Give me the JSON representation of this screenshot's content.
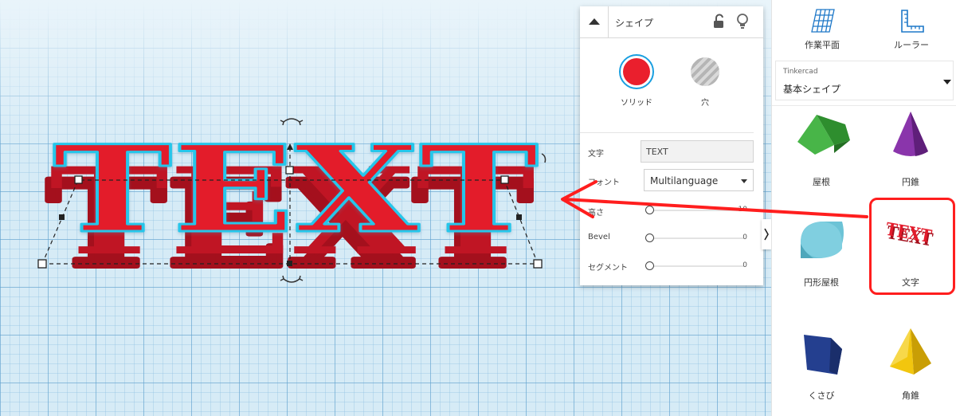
{
  "workplane": {
    "shape_text": "TEXT"
  },
  "shape_panel": {
    "title": "シェイプ",
    "solid_label": "ソリッド",
    "hole_label": "穴",
    "props": {
      "text_label": "文字",
      "text_value": "TEXT",
      "font_label": "フォント",
      "font_value": "Multilanguage",
      "height_label": "高さ",
      "height_value": "10",
      "bevel_label": "Bevel",
      "bevel_value": "0",
      "segments_label": "セグメント",
      "segments_value": "0"
    }
  },
  "sidebar": {
    "tools": [
      {
        "label": "作業平面",
        "icon": "workplane-grid-icon"
      },
      {
        "label": "ルーラー",
        "icon": "ruler-icon"
      }
    ],
    "library": {
      "source": "Tinkercad",
      "category": "基本シェイプ"
    },
    "shapes": [
      {
        "label": "屋根",
        "icon": "roof-icon"
      },
      {
        "label": "円錐",
        "icon": "cone-icon"
      },
      {
        "label": "円形屋根",
        "icon": "round-roof-icon"
      },
      {
        "label": "文字",
        "icon": "text-shape-icon"
      },
      {
        "label": "くさび",
        "icon": "wedge-icon"
      },
      {
        "label": "角錐",
        "icon": "pyramid-icon"
      }
    ]
  },
  "colors": {
    "shape_red": "#e31b2b",
    "selection_outline": "#25c6ea",
    "cone_purple": "#7b2b9a",
    "roof_green": "#3aa63a",
    "round_roof_teal": "#5fb9cf",
    "wedge_navy": "#213a86",
    "pyramid_yellow": "#f2c60e",
    "annotation_red": "#ff1e1e"
  }
}
